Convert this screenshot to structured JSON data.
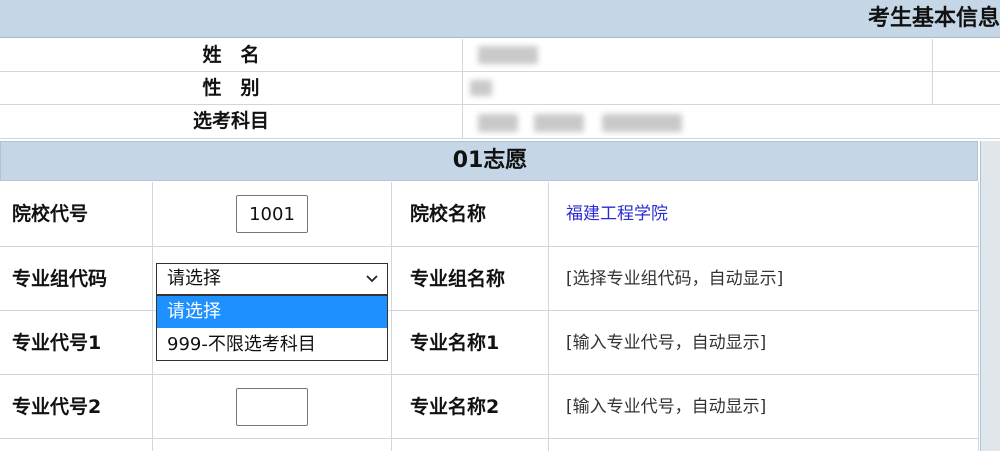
{
  "banner": {
    "title": "考生基本信息"
  },
  "info": {
    "name_label": "姓　名",
    "gender_label": "性　别",
    "subjects_label": "选考科目"
  },
  "volunteer": {
    "title": "01志愿",
    "school_code_label": "院校代号",
    "school_code_value": "1001",
    "school_name_label": "院校名称",
    "school_name_value": "福建工程学院",
    "group_code_label": "专业组代码",
    "group_name_label": "专业组名称",
    "group_name_hint": "[选择专业组代码，自动显示]",
    "major1_code_label": "专业代号1",
    "major1_name_label": "专业名称1",
    "major1_name_hint": "[输入专业代号，自动显示]",
    "major2_code_label": "专业代号2",
    "major2_name_label": "专业名称2",
    "major2_name_hint": "[输入专业代号，自动显示]",
    "group_select": {
      "selected": "请选择",
      "options": [
        "请选择",
        "999-不限选考科目"
      ]
    }
  },
  "colors": {
    "header_bg": "#c5d7e6",
    "highlight": "#1e90ff",
    "link": "#2b2bd6"
  }
}
